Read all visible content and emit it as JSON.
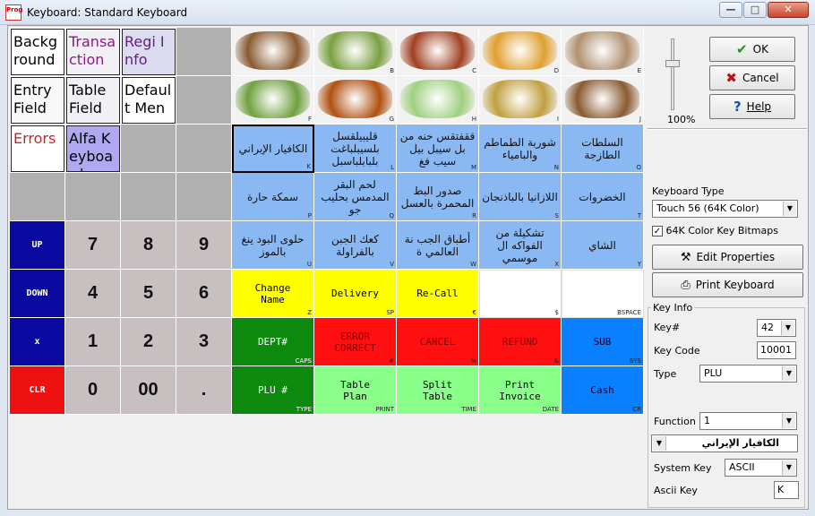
{
  "window": {
    "title": "Keyboard: Standard Keyboard",
    "app_icon": "Prog",
    "minimize": "—",
    "maximize": "□",
    "close": "✕"
  },
  "keys": [
    {
      "name": "key-background",
      "label": "Background",
      "cls": "kbox",
      "fg": "#000",
      "bg": "#fff"
    },
    {
      "name": "key-transaction",
      "label": "Transaction",
      "cls": "kbox",
      "fg": "#8b1a8b",
      "bg": "#f2f0f5"
    },
    {
      "name": "key-regi-info",
      "label": "Regi Info",
      "cls": "kbox",
      "fg": "#6a1a8a",
      "bg": "#dcdcf0"
    },
    {
      "name": "key-blank-1",
      "label": "",
      "cls": "gray"
    },
    {
      "name": "key-img-a",
      "label": "",
      "sub": "",
      "cls": "img",
      "photo": "#8a5a30"
    },
    {
      "name": "key-img-b",
      "label": "",
      "sub": "B",
      "cls": "img",
      "photo": "#7aa040"
    },
    {
      "name": "key-img-c",
      "label": "",
      "sub": "C",
      "cls": "img",
      "photo": "#a04020"
    },
    {
      "name": "key-img-d",
      "label": "",
      "sub": "D",
      "cls": "img",
      "photo": "#e0a030"
    },
    {
      "name": "key-img-e",
      "label": "",
      "sub": "E",
      "cls": "img",
      "photo": "#b09070"
    },
    {
      "name": "key-entry-field",
      "label": "Entry Field",
      "cls": "kbox",
      "fg": "#000",
      "bg": "#f8f8f8"
    },
    {
      "name": "key-table-field",
      "label": "Table Field",
      "cls": "kbox",
      "fg": "#000",
      "bg": "#f2f0f5"
    },
    {
      "name": "key-default-menu",
      "label": "Default Menu",
      "cls": "kbox",
      "fg": "#000",
      "bg": "#fff"
    },
    {
      "name": "key-blank-2",
      "label": "",
      "cls": "gray"
    },
    {
      "name": "key-img-f",
      "label": "",
      "sub": "F",
      "cls": "img",
      "photo": "#70a040"
    },
    {
      "name": "key-img-g",
      "label": "",
      "sub": "G",
      "cls": "img",
      "photo": "#b05010"
    },
    {
      "name": "key-img-h",
      "label": "",
      "sub": "H",
      "cls": "img",
      "photo": "#a0d080"
    },
    {
      "name": "key-img-i",
      "label": "",
      "sub": "I",
      "cls": "img",
      "photo": "#c0a040"
    },
    {
      "name": "key-img-j",
      "label": "",
      "sub": "J",
      "cls": "img",
      "photo": "#8a5a30"
    },
    {
      "name": "key-errors",
      "label": "Errors",
      "cls": "kbox",
      "fg": "#d02020",
      "bg": "#fff"
    },
    {
      "name": "key-alfa-keyboard",
      "label": "Alfa Keyboard",
      "cls": "kbox",
      "fg": "#000",
      "bg": "#b0a8f0"
    },
    {
      "name": "key-blank-3",
      "label": "",
      "cls": "gray"
    },
    {
      "name": "key-blank-4",
      "label": "",
      "cls": "gray"
    },
    {
      "name": "key-k",
      "label": "الكافيار الإيراني",
      "sub": "K",
      "cls": "lb sel"
    },
    {
      "name": "key-l",
      "label": "قليبيلقسل بلسيبلباغت بلبابلباسبل",
      "sub": "L",
      "cls": "lb"
    },
    {
      "name": "key-m",
      "label": "ققفتقس حنه من بل سيبل بيل سيب فغ",
      "sub": "M",
      "cls": "lb"
    },
    {
      "name": "key-n",
      "label": "شوربة الطماطم والبامياء",
      "sub": "N",
      "cls": "lb"
    },
    {
      "name": "key-o",
      "label": "السلطات الطازجة",
      "sub": "O",
      "cls": "lb"
    },
    {
      "name": "key-blank-5",
      "label": "",
      "cls": "gray"
    },
    {
      "name": "key-blank-6",
      "label": "",
      "cls": "gray"
    },
    {
      "name": "key-blank-7",
      "label": "",
      "cls": "gray"
    },
    {
      "name": "key-blank-8",
      "label": "",
      "cls": "gray"
    },
    {
      "name": "key-p",
      "label": "سمكة حارة",
      "sub": "P",
      "cls": "lb"
    },
    {
      "name": "key-q",
      "label": "لحم البقر المدمس بحليب جو",
      "sub": "Q",
      "cls": "lb"
    },
    {
      "name": "key-r",
      "label": "صدور البط المحمرة بالعسل",
      "sub": "R",
      "cls": "lb"
    },
    {
      "name": "key-s",
      "label": "اللازانيا بالباذنجان",
      "sub": "S",
      "cls": "lb"
    },
    {
      "name": "key-t",
      "label": "الخضروات",
      "sub": "T",
      "cls": "lb"
    },
    {
      "name": "key-up",
      "label": "UP",
      "cls": "blue"
    },
    {
      "name": "key-7",
      "label": "7",
      "cls": "num numbg"
    },
    {
      "name": "key-8",
      "label": "8",
      "cls": "num numbg"
    },
    {
      "name": "key-9",
      "label": "9",
      "cls": "num numbg"
    },
    {
      "name": "key-u",
      "label": "حلوى البود ينغ بالموز",
      "sub": "U",
      "cls": "lb"
    },
    {
      "name": "key-v",
      "label": "كعك الجبن بالفراولة",
      "sub": "V",
      "cls": "lb"
    },
    {
      "name": "key-w",
      "label": "أطباق الجب نة العالمي ة",
      "sub": "W",
      "cls": "lb"
    },
    {
      "name": "key-x",
      "label": "تشكيلة من الفواكه ال موسمي",
      "sub": "X",
      "cls": "lb"
    },
    {
      "name": "key-y",
      "label": "الشاي",
      "sub": "Y",
      "cls": "lb"
    },
    {
      "name": "key-down",
      "label": "DOWN",
      "cls": "blue"
    },
    {
      "name": "key-4",
      "label": "4",
      "cls": "num numbg"
    },
    {
      "name": "key-5",
      "label": "5",
      "cls": "num numbg"
    },
    {
      "name": "key-6",
      "label": "6",
      "cls": "num numbg"
    },
    {
      "name": "key-change-name",
      "label": "Change\nName",
      "sub": "Z",
      "cls": "yel mono"
    },
    {
      "name": "key-delivery",
      "label": "Delivery",
      "sub": "SP",
      "cls": "yel mono"
    },
    {
      "name": "key-recall",
      "label": "Re-Call",
      "sub": "€",
      "cls": "yel mono"
    },
    {
      "name": "key-dollar",
      "label": "",
      "sub": "$",
      "cls": "wht"
    },
    {
      "name": "key-bspace",
      "label": "",
      "sub": "BSPACE",
      "cls": "wht"
    },
    {
      "name": "key-x-mult",
      "label": "x",
      "cls": "blue"
    },
    {
      "name": "key-1",
      "label": "1",
      "cls": "num numbg"
    },
    {
      "name": "key-2",
      "label": "2",
      "cls": "num numbg"
    },
    {
      "name": "key-3",
      "label": "3",
      "cls": "num numbg"
    },
    {
      "name": "key-dept",
      "label": "DEPT#",
      "sub": "CAPS",
      "cls": "grn mono",
      "fg": "#fff"
    },
    {
      "name": "key-error-correct",
      "label": "ERROR\nCORRECT",
      "sub": "#",
      "cls": "rd2 mono",
      "fg": "#800"
    },
    {
      "name": "key-cancel",
      "label": "CANCEL",
      "sub": "%",
      "cls": "rd2 mono",
      "fg": "#800"
    },
    {
      "name": "key-refund",
      "label": "REFUND",
      "sub": "&",
      "cls": "rd2 mono",
      "fg": "#800"
    },
    {
      "name": "key-sub",
      "label": "SUB",
      "sub": "SYS",
      "cls": "sblue mono",
      "fg": "#003"
    },
    {
      "name": "key-clr",
      "label": "CLR",
      "cls": "red"
    },
    {
      "name": "key-0",
      "label": "0",
      "cls": "num numbg"
    },
    {
      "name": "key-00",
      "label": "00",
      "cls": "num numbg"
    },
    {
      "name": "key-dot",
      "label": ".",
      "cls": "num numbg"
    },
    {
      "name": "key-plu",
      "label": "PLU #",
      "sub": "TYPE",
      "cls": "grn mono",
      "fg": "#fff"
    },
    {
      "name": "key-table-plan",
      "label": "Table\nPlan",
      "sub": "PRINT",
      "cls": "lgrn mono",
      "fg": "#000"
    },
    {
      "name": "key-split-table",
      "label": "Split\nTable",
      "sub": "TIME",
      "cls": "lgrn mono",
      "fg": "#000"
    },
    {
      "name": "key-print-invoice",
      "label": "Print\nInvoice",
      "sub": "DATE",
      "cls": "lgrn mono",
      "fg": "#000"
    },
    {
      "name": "key-cash",
      "label": "Cash",
      "sub": "CR",
      "cls": "sblue mono",
      "fg": "#003"
    }
  ],
  "side": {
    "slider_value": "100%",
    "ok": "OK",
    "cancel": "Cancel",
    "help": "Help",
    "keyboard_type_label": "Keyboard Type",
    "keyboard_type_value": "Touch 56 (64K Color)",
    "color_bitmaps_label": "64K Color Key Bitmaps",
    "color_bitmaps_checked": "✓",
    "edit_properties": "Edit Properties",
    "print_keyboard": "Print Keyboard",
    "key_info_label": "Key Info",
    "key_num_label": "Key#",
    "key_num_value": "42",
    "key_code_label": "Key Code",
    "key_code_value": "10001",
    "type_label": "Type",
    "type_value": "PLU",
    "function_label": "Function",
    "function_value": "1",
    "function_name_value": "الكافيار الإيراني",
    "system_key_label": "System Key",
    "system_key_value": "ASCII",
    "ascii_key_label": "Ascii Key",
    "ascii_key_value": "K",
    "colors": {
      "ok_check": "#1a9a1a",
      "cancel_x": "#c01010",
      "help_q": "#1050c0"
    }
  }
}
